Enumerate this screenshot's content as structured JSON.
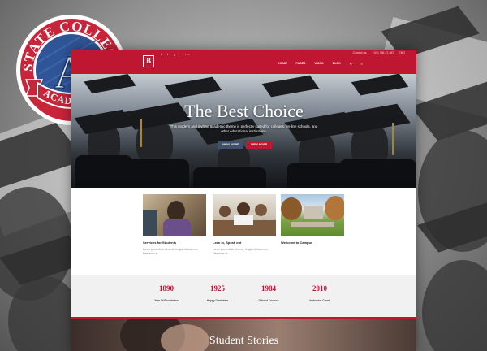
{
  "badge": {
    "top_text": "STATE COLLEGE",
    "letter": "A",
    "ribbon_text": "ACADEMIC",
    "colors": {
      "red": "#c8243a",
      "blue": "#2f5597",
      "white": "#ffffff"
    }
  },
  "topbar": {
    "phone": "+1(0) 786-27-867",
    "extra": "Contact us:",
    "lang": "ENG"
  },
  "logo": {
    "letter": "B"
  },
  "nav": {
    "items": [
      "HOME",
      "PAGES",
      "WORK",
      "BLOG"
    ]
  },
  "hero": {
    "title": "The Best Choice",
    "text": "This modern and inviting academic theme is perfectly suited for colleges, on-line schools, and other educational institutions.",
    "button_primary": "VIEW MORE",
    "button_secondary": "VIEW MORE"
  },
  "cards": [
    {
      "title": "Services for Students",
      "text": "Lorem ipsum dolor sit amet, feugiat delicata nec, Maecenas et."
    },
    {
      "title": "Lean in, Speak out",
      "text": "Lorem ipsum dolor sit amet, feugiat delicata nec, Maecenas et."
    },
    {
      "title": "Welcome to Campus",
      "text": ""
    }
  ],
  "stats": [
    {
      "number": "1890",
      "label": "Year Of Foundation"
    },
    {
      "number": "1925",
      "label": "Happy Graduates"
    },
    {
      "number": "1984",
      "label": "Offered Courses"
    },
    {
      "number": "2010",
      "label": "Instructor Count"
    }
  ],
  "stories": {
    "title": "Student Stories"
  },
  "theme": {
    "accent": "#bf1731",
    "dark": "#3f4f6e"
  }
}
